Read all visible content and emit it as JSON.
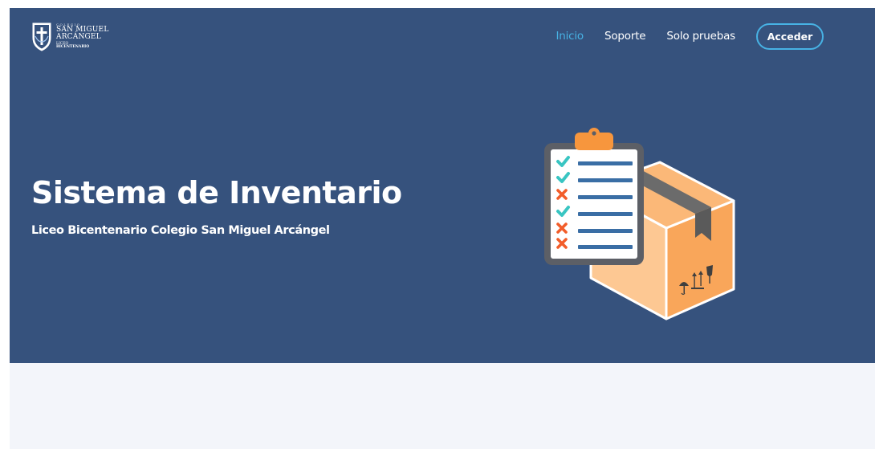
{
  "header": {
    "logo": {
      "line0": "COLEGIO",
      "line1": "SAN MIGUEL",
      "line2": "ARCÁNGEL",
      "line3": "LICEO",
      "line4": "BICENTENARIO"
    },
    "nav": [
      {
        "label": "Inicio",
        "active": true
      },
      {
        "label": "Soporte",
        "active": false
      },
      {
        "label": "Solo pruebas",
        "active": false
      }
    ],
    "login_button": "Acceder"
  },
  "hero": {
    "title": "Sistema de Inventario",
    "subtitle": "Liceo Bicentenario Colegio San Miguel Arcángel",
    "illustration": "clipboard-checklist-and-box-icon"
  },
  "colors": {
    "hero_bg": "#36527d",
    "accent": "#47b2e4",
    "lower_bg": "#f3f5fa",
    "box": "#f9a65a",
    "clipboard_clip": "#f7963d"
  }
}
